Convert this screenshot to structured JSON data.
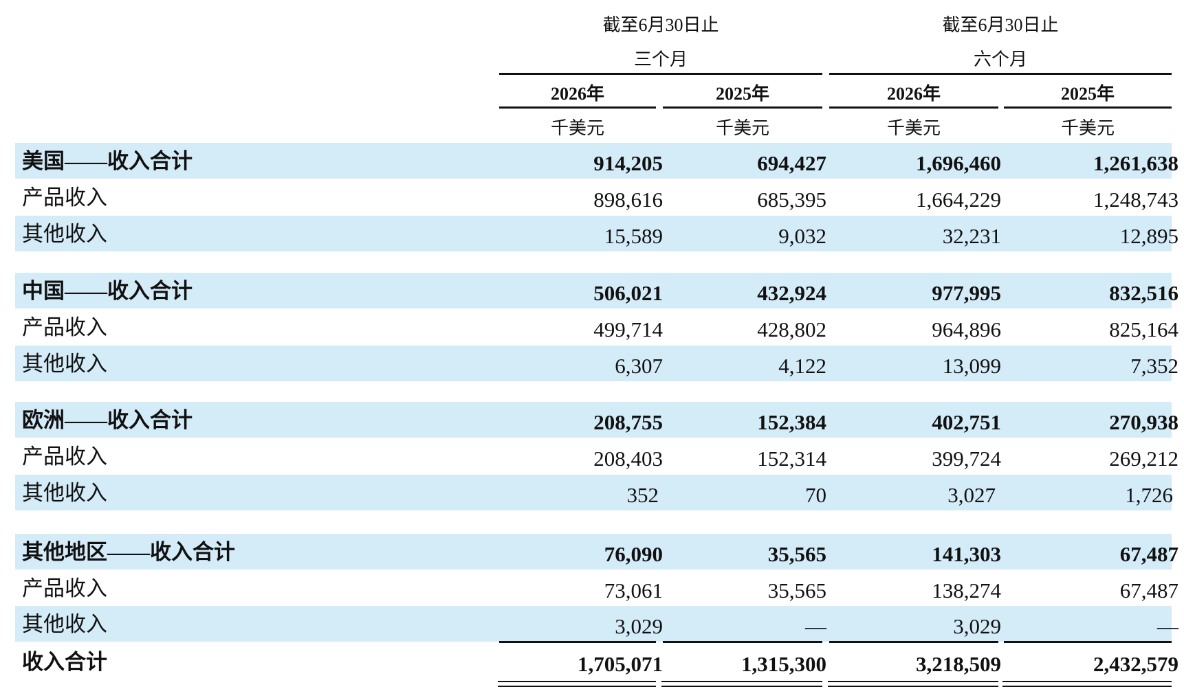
{
  "header": {
    "group1_line1": "截至6月30日止",
    "group1_line2": "三个月",
    "group2_line1": "截至6月30日止",
    "group2_line2": "六个月",
    "years": [
      "2026年",
      "2025年",
      "2026年",
      "2025年"
    ],
    "units": [
      "千美元",
      "千美元",
      "千美元",
      "千美元"
    ]
  },
  "rows": [
    {
      "label": "美国——收入合计",
      "values": [
        "914,205",
        "694,427",
        "1,696,460",
        "1,261,638"
      ]
    },
    {
      "label": "产品收入",
      "values": [
        "898,616",
        "685,395",
        "1,664,229",
        "1,248,743"
      ]
    },
    {
      "label": "其他收入",
      "values": [
        "15,589",
        "9,032",
        "32,231",
        "12,895"
      ]
    },
    {
      "label": "中国——收入合计",
      "values": [
        "506,021",
        "432,924",
        "977,995",
        "832,516"
      ]
    },
    {
      "label": "产品收入",
      "values": [
        "499,714",
        "428,802",
        "964,896",
        "825,164"
      ]
    },
    {
      "label": "其他收入",
      "values": [
        "6,307",
        "4,122",
        "13,099",
        "7,352"
      ]
    },
    {
      "label": "欧洲——收入合计",
      "values": [
        "208,755",
        "152,384",
        "402,751",
        "270,938"
      ]
    },
    {
      "label": "产品收入",
      "values": [
        "208,403",
        "152,314",
        "399,724",
        "269,212"
      ]
    },
    {
      "label": "其他收入",
      "values": [
        "352",
        "70",
        "3,027",
        "1,726"
      ]
    },
    {
      "label": "其他地区——收入合计",
      "values": [
        "76,090",
        "35,565",
        "141,303",
        "67,487"
      ]
    },
    {
      "label": "产品收入",
      "values": [
        "73,061",
        "35,565",
        "138,274",
        "67,487"
      ]
    },
    {
      "label": "其他收入",
      "values": [
        "3,029",
        "—",
        "3,029",
        "—"
      ]
    }
  ],
  "total": {
    "label": "收入合计",
    "values": [
      "1,705,071",
      "1,315,300",
      "3,218,509",
      "2,432,579"
    ]
  }
}
